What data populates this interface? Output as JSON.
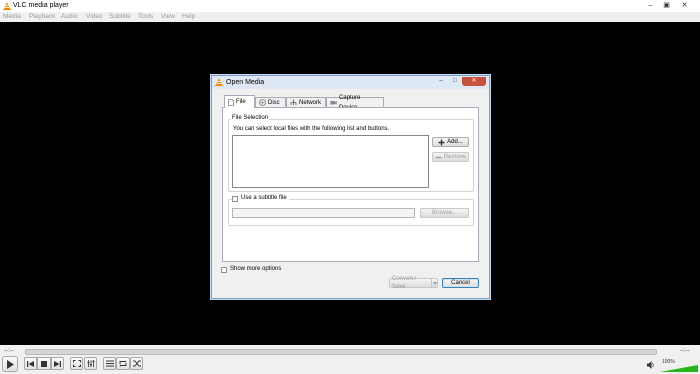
{
  "window": {
    "title": "VLC media player"
  },
  "menu": [
    "Media",
    "Playback",
    "Audio",
    "Video",
    "Subtitle",
    "Tools",
    "View",
    "Help"
  ],
  "controls": {
    "time_elapsed": "--:--",
    "time_total": "--:--",
    "volume": "100%",
    "volume_level": 1.0
  },
  "dialog": {
    "title": "Open Media",
    "tabs": [
      "File",
      "Disc",
      "Network",
      "Capture Device"
    ],
    "active_tab": "File",
    "file_selection": {
      "group_label": "File Selection",
      "description": "You can select local files with the following list and buttons.",
      "add_label": "Add...",
      "remove_label": "Remove"
    },
    "subtitle": {
      "checkbox_label": "Use a subtitle file",
      "browse_label": "Browse..."
    },
    "show_more_label": "Show more options",
    "convert_label": "Convert / Save",
    "cancel_label": "Cancel"
  },
  "icons": [
    "vlc-cone-icon",
    "minimize-icon",
    "maximize-icon",
    "close-icon",
    "play-icon",
    "previous-icon",
    "stop-icon",
    "next-icon",
    "fullscreen-icon",
    "extended-settings-icon",
    "playlist-icon",
    "loop-icon",
    "shuffle-icon",
    "volume-icon",
    "file-icon",
    "disc-icon",
    "network-icon",
    "capture-device-icon",
    "add-icon",
    "remove-icon",
    "dropdown-arrow-icon"
  ],
  "colors": {
    "dialog_border": "#7a9fc5",
    "close_button": "#c7503e",
    "volume_fill": "#27b51b",
    "cancel_border": "#3c7fb1"
  }
}
